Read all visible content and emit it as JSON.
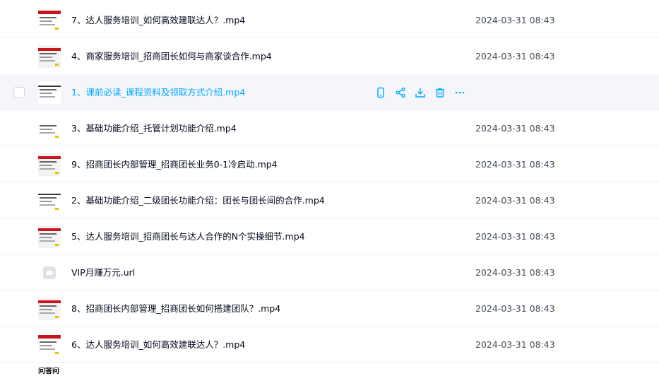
{
  "files": [
    {
      "name": "7、达人服务培训_如何高效建联达人？.mp4",
      "date": "2024-03-31 08:43",
      "thumb": "video"
    },
    {
      "name": "4、商家服务培训_招商团长如何与商家谈合作.mp4",
      "date": "2024-03-31 08:43",
      "thumb": "video"
    },
    {
      "name": "1、课前必读_课程资料及领取方式介绍.mp4",
      "date": "",
      "thumb": "video",
      "hover": true
    },
    {
      "name": "3、基础功能介绍_托管计划功能介绍.mp4",
      "date": "2024-03-31 08:43",
      "thumb": "video"
    },
    {
      "name": "9、招商团长内部管理_招商团长业务0-1冷启动.mp4",
      "date": "2024-03-31 08:43",
      "thumb": "video"
    },
    {
      "name": "2、基础功能介绍_二级团长功能介绍：团长与团长间的合作.mp4",
      "date": "2024-03-31 08:43",
      "thumb": "video"
    },
    {
      "name": "5、达人服务培训_招商团长与达人合作的N个实操细节.mp4",
      "date": "2024-03-31 08:43",
      "thumb": "video"
    },
    {
      "name": "VIP月赚万元.url",
      "date": "2024-03-31 08:43",
      "thumb": "link"
    },
    {
      "name": "8、招商团长内部管理_招商团长如何搭建团队？.mp4",
      "date": "2024-03-31 08:43",
      "thumb": "video"
    },
    {
      "name": "6、达人服务培训_如何高效建联达人？.mp4",
      "date": "2024-03-31 08:43",
      "thumb": "video"
    }
  ],
  "partial_row_thumb_text": "问答问",
  "hover_actions": [
    {
      "icon": "phone-icon"
    },
    {
      "icon": "share-icon"
    },
    {
      "icon": "download-icon"
    },
    {
      "icon": "trash-icon"
    },
    {
      "icon": "more-icon"
    }
  ],
  "colors": {
    "accent": "#06a7ff",
    "hover_bg": "#f5f6fa",
    "text": "#03081a",
    "date_text": "#454d5a"
  }
}
